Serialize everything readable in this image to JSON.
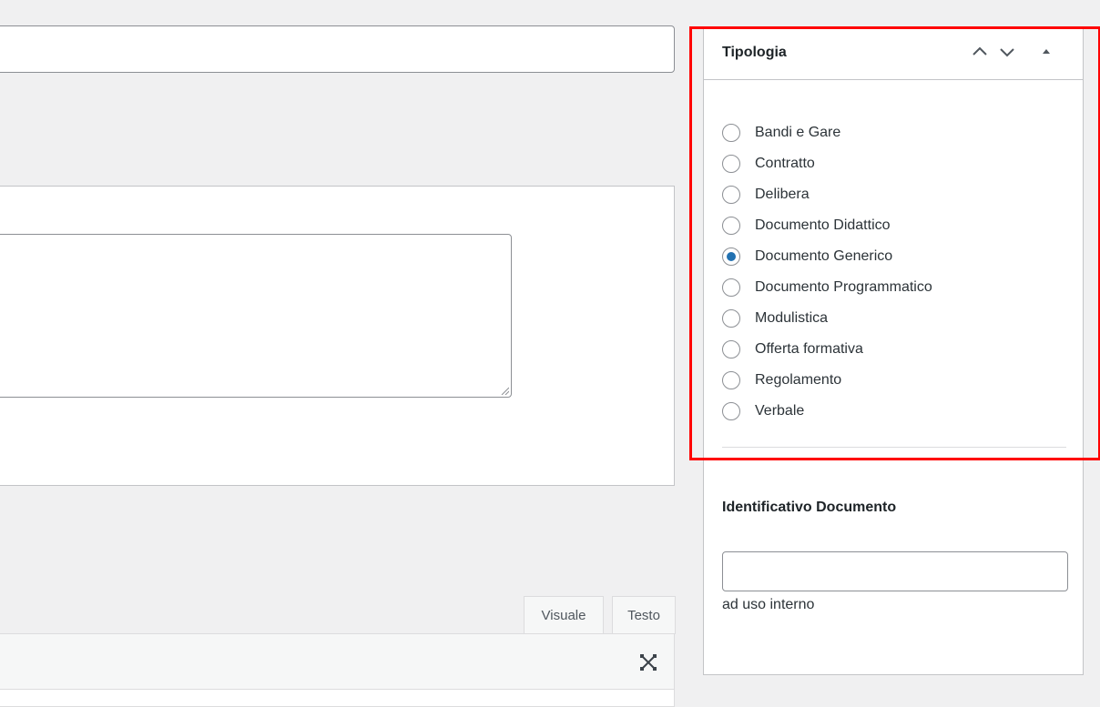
{
  "metabox": {
    "title": "Tipologia",
    "controls": [
      "move-up",
      "move-down",
      "toggle"
    ],
    "options": [
      {
        "label": "Bandi e Gare",
        "checked": false
      },
      {
        "label": "Contratto",
        "checked": false
      },
      {
        "label": "Delibera",
        "checked": false
      },
      {
        "label": "Documento Didattico",
        "checked": false
      },
      {
        "label": "Documento Generico",
        "checked": true
      },
      {
        "label": "Documento Programmatico",
        "checked": false
      },
      {
        "label": "Modulistica",
        "checked": false
      },
      {
        "label": "Offerta formativa",
        "checked": false
      },
      {
        "label": "Regolamento",
        "checked": false
      },
      {
        "label": "Verbale",
        "checked": false
      }
    ]
  },
  "identifier": {
    "heading": "Identificativo Documento",
    "value": "",
    "hint": "ad uso interno"
  },
  "editor": {
    "tabs": [
      {
        "label": "Visuale",
        "active": true
      },
      {
        "label": "Testo",
        "active": false
      }
    ]
  },
  "colors": {
    "accent": "#2271b1",
    "highlight": "#ff0000"
  }
}
